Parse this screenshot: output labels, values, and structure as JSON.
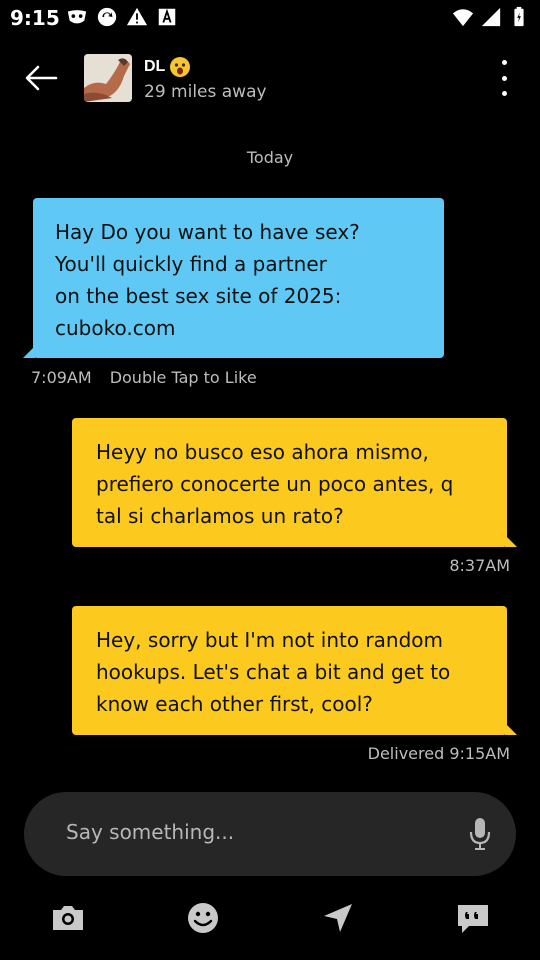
{
  "status_bar": {
    "time": "9:15",
    "left_icons": [
      "mask-icon",
      "sync-icon",
      "warning-icon",
      "a-box-icon"
    ],
    "right_icons": [
      "wifi-icon",
      "signal-icon",
      "battery-icon"
    ]
  },
  "header": {
    "name": "DL",
    "name_emoji": "astonished-face-icon",
    "distance": "29 miles away"
  },
  "conversation": {
    "date_separator": "Today",
    "messages": [
      {
        "direction": "incoming",
        "text": "Hay Do you want to have sex? You'll quickly find a partner on the best sex site of 2025: cuboko.com",
        "lines": [
          "Hay Do you want to have sex?",
          "You'll quickly find a partner",
          "on the best sex site of 2025:",
          "cuboko.com"
        ],
        "time": "7:09AM",
        "hint": "Double Tap to Like",
        "color": "#5fc8f5"
      },
      {
        "direction": "outgoing",
        "lines": [
          "Heyy no busco eso ahora mismo,",
          "prefiero conocerte un poco antes, q",
          "tal si charlamos un rato?"
        ],
        "time": "8:37AM",
        "color": "#fcca1f"
      },
      {
        "direction": "outgoing",
        "lines": [
          "Hey, sorry but I'm not into random",
          "hookups. Let's chat a bit and get to",
          "know each other first, cool?"
        ],
        "time": "Delivered 9:15AM",
        "color": "#fcca1f"
      }
    ]
  },
  "composer": {
    "placeholder": "Say something..."
  },
  "toolbar": {
    "icons": [
      "camera-icon",
      "emoji-icon",
      "location-icon",
      "quick-replies-icon"
    ]
  }
}
